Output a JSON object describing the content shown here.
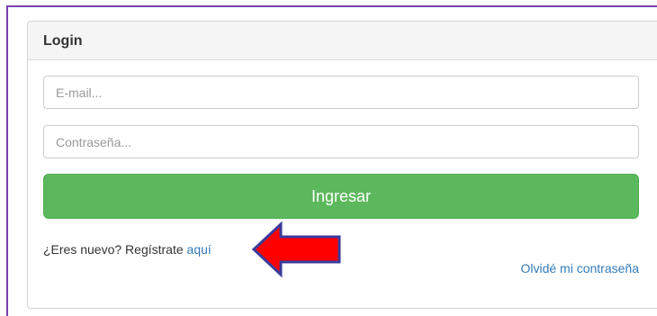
{
  "panel": {
    "title": "Login"
  },
  "form": {
    "email_placeholder": "E-mail...",
    "password_placeholder": "Contraseña...",
    "submit_label": "Ingresar"
  },
  "links": {
    "register_text": "¿Eres nuevo? Regístrate ",
    "register_link": "aquí",
    "forgot_password": "Olvidé mi contraseña"
  },
  "annotation": {
    "arrow_icon": "red-arrow-left-icon",
    "arrow_color": "#ff0000",
    "arrow_outline": "#3b3b9b"
  },
  "colors": {
    "primary_button": "#5cb85c",
    "link": "#337ab7",
    "frame_border": "#7a3fb0"
  }
}
